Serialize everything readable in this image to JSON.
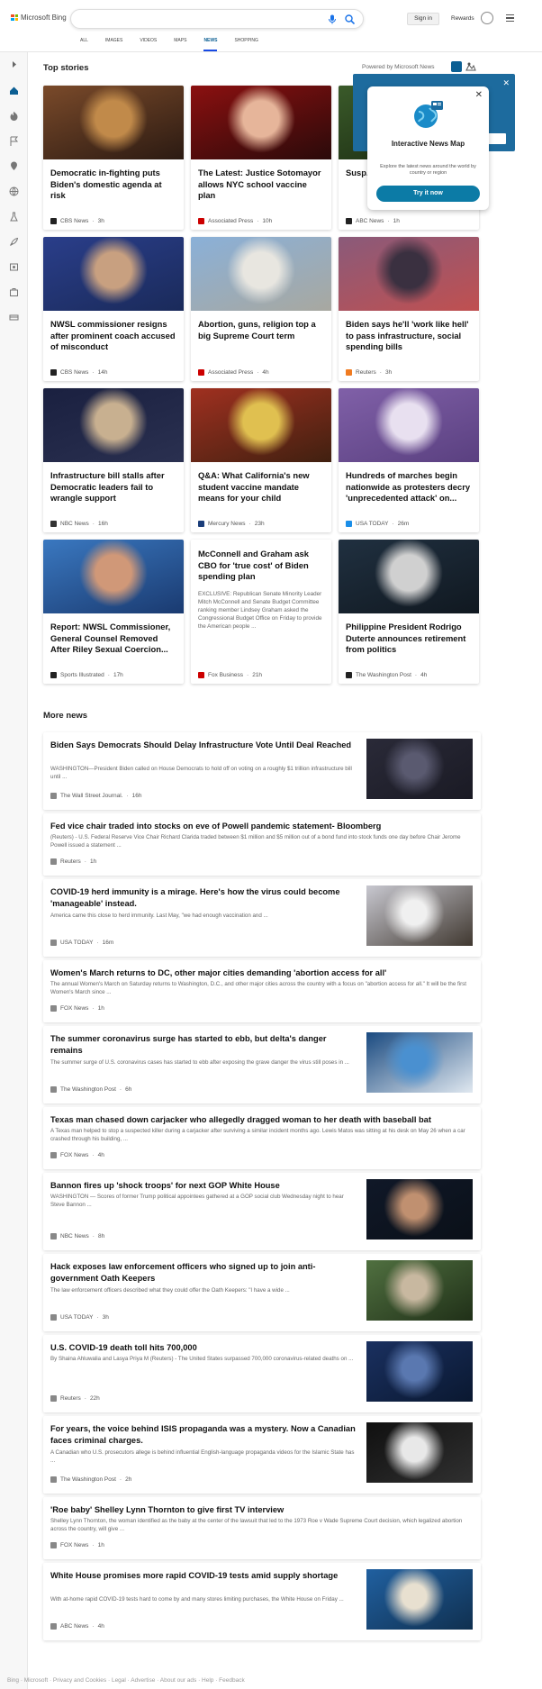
{
  "header": {
    "logo_text": "Microsoft Bing",
    "search_value": "",
    "signin": "Sign in",
    "rewards": "Rewards"
  },
  "tabs": [
    "ALL",
    "IMAGES",
    "VIDEOS",
    "MAPS",
    "NEWS",
    "SHOPPING"
  ],
  "active_tab": "NEWS",
  "top_stories_title": "Top stories",
  "powered_by": "Powered by Microsoft News",
  "popup": {
    "title": "Interactive News Map",
    "desc": "Explore the latest news around the world by country or region",
    "button": "Try it now"
  },
  "top_stories": [
    {
      "title": "Democratic in-fighting puts Biden's domestic agenda at risk",
      "source": "CBS News",
      "time": "3h",
      "src_color": "#222",
      "img": [
        "#7a4a2a",
        "#c18a4a",
        "#2b1a12"
      ]
    },
    {
      "title": "The Latest: Justice Sotomayor allows NYC school vaccine plan",
      "source": "Associated Press",
      "time": "10h",
      "src_color": "#c00",
      "img": [
        "#8b1010",
        "#e6b59a",
        "#2a0a0a"
      ]
    },
    {
      "title": "Susp... shoo...",
      "source": "ABC News",
      "time": "1h",
      "src_color": "#222",
      "img": [
        "#3a5a2a",
        "#6a8a4a",
        "#1a2a10"
      ]
    },
    {
      "title": "NWSL commissioner resigns after prominent coach accused of misconduct",
      "source": "CBS News",
      "time": "14h",
      "src_color": "#222",
      "img": [
        "#2a3e8a",
        "#c8a080",
        "#1a2a5a"
      ]
    },
    {
      "title": "Abortion, guns, religion top a big Supreme Court term",
      "source": "Associated Press",
      "time": "4h",
      "src_color": "#c00",
      "img": [
        "#8ab0d8",
        "#e8e6e0",
        "#a8a8a0"
      ]
    },
    {
      "title": "Biden says he'll 'work like hell' to pass infrastructure, social spending bills",
      "source": "Reuters",
      "time": "3h",
      "src_color": "#f07b20",
      "img": [
        "#8a5a7a",
        "#3a3040",
        "#c05050"
      ]
    },
    {
      "title": "Infrastructure bill stalls after Democratic leaders fail to wrangle support",
      "source": "NBC News",
      "time": "16h",
      "src_color": "#333",
      "img": [
        "#1a2040",
        "#c8b090",
        "#2a3050"
      ]
    },
    {
      "title": "Q&A: What California's new student vaccine mandate means for your child",
      "source": "Mercury News",
      "time": "23h",
      "src_color": "#1b3d7a",
      "img": [
        "#a03020",
        "#e0c050",
        "#402010"
      ]
    },
    {
      "title": "Hundreds of marches begin nationwide as protesters decry 'unprecedented attack' on...",
      "source": "USA TODAY",
      "time": "26m",
      "src_color": "#1a8ee8",
      "img": [
        "#8060a8",
        "#e8e0f0",
        "#5a4080"
      ]
    },
    {
      "title": "Report: NWSL Commissioner, General Counsel Removed After Riley Sexual Coercion...",
      "source": "Sports Illustrated",
      "time": "17h",
      "src_color": "#222",
      "img": [
        "#3a78c0",
        "#d09878",
        "#1a3a70"
      ]
    },
    {
      "title": "McConnell and Graham ask CBO for 'true cost' of Biden spending plan",
      "desc": "EXCLUSIVE: Republican Senate Minority Leader Mitch McConnell and Senate Budget Committee ranking member Lindsey Graham asked the Congressional Budget Office on Friday to provide the American people ...",
      "source": "Fox Business",
      "time": "21h",
      "src_color": "#c00"
    },
    {
      "title": "Philippine President Rodrigo Duterte announces retirement from politics",
      "source": "The Washington Post",
      "time": "4h",
      "src_color": "#222",
      "img": [
        "#203040",
        "#d0d0d0",
        "#101820"
      ]
    }
  ],
  "more_news_title": "More news",
  "more_news": [
    {
      "title": "Biden Says Democrats Should Delay Infrastructure Vote Until Deal Reached",
      "desc": "WASHINGTON—President Biden called on House Democrats to hold off on voting on a roughly $1 trillion infrastructure bill until ...",
      "source": "The Wall Street Journal.",
      "time": "16h",
      "img": [
        "#2a2a38",
        "#5a5a70",
        "#1a1a24"
      ],
      "h": 86
    },
    {
      "title": "Fed vice chair traded into stocks on eve of Powell pandemic statement- Bloomberg",
      "desc": "(Reuters) - U.S. Federal Reserve Vice Chair Richard Clarida traded between $1 million and $5 million out of a bond fund into stock funds one day before Chair Jerome Powell issued a statement ...",
      "source": "Reuters",
      "time": "1h",
      "h": 69
    },
    {
      "title": "COVID-19 herd immunity is a mirage. Here's how the virus could become 'manageable' instead.",
      "desc": "America came this close to herd immunity.          Last May, \"we had enough vaccination and ...",
      "source": "USA TODAY",
      "time": "16m",
      "img": [
        "#c8c8d0",
        "#f0f0f0",
        "#403830"
      ],
      "h": 86
    },
    {
      "title": "Women's March returns to DC, other major cities demanding 'abortion access for all'",
      "desc": "The annual Women's March on Saturday returns to Washington, D.C., and other major cities across the country with a focus on \"abortion access for all.\" It will be the first Women's March since ...",
      "source": "FOX News",
      "time": "1h",
      "h": 69
    },
    {
      "title": "The summer coronavirus surge has started to ebb, but delta's danger remains",
      "desc": "The summer surge of U.S. coronavirus cases has started to ebb after exposing the grave danger the virus still poses in ...",
      "source": "The Washington Post",
      "time": "6h",
      "img": [
        "#1a4a80",
        "#4a90d0",
        "#e0e8f0"
      ],
      "h": 86
    },
    {
      "title": "Texas man chased down carjacker who allegedly dragged woman to her death with baseball bat",
      "desc": "A Texas man helped to stop a suspected killer during a carjacker after surviving a similar incident months ago.  Lewis Matos was sitting at his desk on May 26 when a car crashed through his building, ...",
      "source": "FOX News",
      "time": "4h",
      "h": 69
    },
    {
      "title": "Bannon fires up 'shock troops' for next GOP White House",
      "desc": "WASHINGTON — Scores of former Trump political appointees gathered at a GOP social club Wednesday night to hear Steve Bannon ...",
      "source": "NBC News",
      "time": "8h",
      "img": [
        "#101828",
        "#c09070",
        "#0a1018"
      ],
      "h": 86
    },
    {
      "title": "Hack exposes law enforcement officers who signed up to join anti-government Oath Keepers",
      "desc": "The law enforcement officers described what they could offer the Oath Keepers: \"I have a wide ...",
      "source": "USA TODAY",
      "time": "3h",
      "img": [
        "#507040",
        "#c8b8a0",
        "#203018"
      ],
      "h": 86
    },
    {
      "title": "U.S. COVID-19 death toll hits 700,000",
      "desc": "By Shaina Ahluwalia and Lasya Priya M (Reuters) - The United States surpassed 700,000 coronavirus-related deaths on ...",
      "source": "Reuters",
      "time": "22h",
      "img": [
        "#1a3060",
        "#5a78b0",
        "#0a1830"
      ],
      "h": 86
    },
    {
      "title": "For years, the voice behind ISIS propaganda was a mystery. Now a Canadian faces criminal charges.",
      "desc": "A Canadian who U.S. prosecutors allege is behind influential English-language propaganda videos for the Islamic State has ...",
      "source": "The Washington Post",
      "time": "2h",
      "img": [
        "#101010",
        "#e8e8e8",
        "#303030"
      ],
      "h": 86
    },
    {
      "title": "'Roe baby' Shelley Lynn Thornton to give first TV interview",
      "desc": "Shelley Lynn Thornton, the woman identified as the baby at the center of the lawsuit that led to the 1973 Roe v Wade Supreme Court decision, which legalized abortion across the country, will give ...",
      "source": "FOX News",
      "time": "1h",
      "h": 69
    },
    {
      "title": "White House promises more rapid COVID-19 tests amid supply shortage",
      "desc": "With at-home rapid COVID-19 tests hard to come by and many stores limiting purchases, the White House on Friday ...",
      "source": "ABC News",
      "time": "4h",
      "img": [
        "#2060a0",
        "#e8e0d0",
        "#103050"
      ],
      "h": 86
    }
  ],
  "footer_text": "Bing · Microsoft · Privacy and Cookies · Legal · Advertise · About our ads · Help · Feedback"
}
